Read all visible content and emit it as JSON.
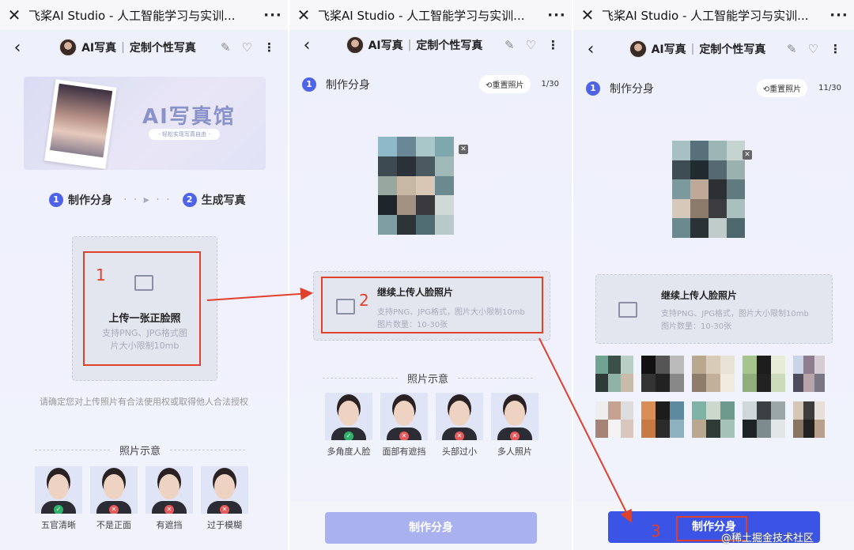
{
  "window_title": "飞桨AI Studio - 人工智能学习与实训...",
  "app_title": "AI写真",
  "app_subtitle": "定制个性写真",
  "panel1": {
    "banner_title": "AI写真馆",
    "banner_sub": "· 轻松实现写真自由 ·",
    "step1_num": "1",
    "step1_label": "制作分身",
    "step2_num": "2",
    "step2_label": "生成写真",
    "upload_title": "上传一张正脸照",
    "upload_hint": "支持PNG、JPG格式图片大小限制10mb",
    "annotation": "1",
    "legal": "请确定您对上传照片有合法使用权或取得他人合法授权",
    "examples_title": "照片示意",
    "examples": [
      {
        "label": "五官清晰",
        "ok": true
      },
      {
        "label": "不是正面",
        "ok": false
      },
      {
        "label": "有遮挡",
        "ok": false
      },
      {
        "label": "过于模糊",
        "ok": false
      }
    ]
  },
  "panel2": {
    "step_num": "1",
    "step_title": "制作分身",
    "reset_label": "⟲重置照片",
    "count": "1/30",
    "upload_title": "继续上传人脸照片",
    "upload_hint1": "支持PNG、JPG格式，图片大小限制10mb",
    "upload_hint2": "图片数量：10-30张",
    "annotation": "2",
    "examples_title": "照片示意",
    "examples": [
      {
        "label": "多角度人脸",
        "ok": true
      },
      {
        "label": "面部有遮挡",
        "ok": false
      },
      {
        "label": "头部过小",
        "ok": false
      },
      {
        "label": "多人照片",
        "ok": false
      }
    ],
    "button": "制作分身"
  },
  "panel3": {
    "step_num": "1",
    "step_title": "制作分身",
    "reset_label": "⟲重置照片",
    "count": "11/30",
    "upload_title": "继续上传人脸照片",
    "upload_hint1": "支持PNG、JPG格式，图片大小限制10mb",
    "upload_hint2": "图片数量：10-30张",
    "annotation": "3",
    "button": "制作分身"
  },
  "watermark": "@稀土掘金技术社区",
  "colors": {
    "accent": "#3b54e6",
    "annotation_red": "#e0412c",
    "ok": "#2fb36a",
    "no": "#e55a5a"
  }
}
